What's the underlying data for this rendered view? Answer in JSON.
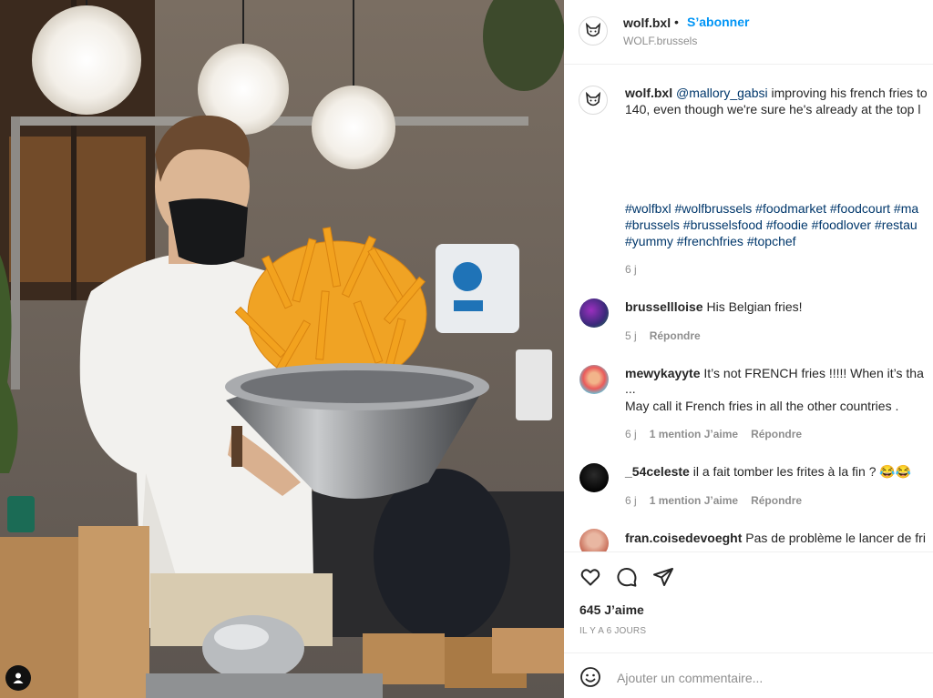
{
  "header": {
    "username": "wolf.bxl",
    "separator": "•",
    "follow_label": "S’abonner",
    "location": "WOLF.brussels"
  },
  "caption": {
    "username": "wolf.bxl",
    "mention": "@mallory_gabsi",
    "line1": "improving his french fries to",
    "line2": "140, even though we're sure he's already at the top l",
    "hashtags_line1": "#wolfbxl #wolfbrussels #foodmarket #foodcourt #ma",
    "hashtags_line2": "#brussels #brusselsfood #foodie #foodlover #restau",
    "hashtags_line3": "#yummy #frenchfries #topchef",
    "age": "6 j"
  },
  "comments": [
    {
      "username": "brussellloise",
      "text": "His Belgian fries!",
      "age": "5 j",
      "likes": "",
      "reply": "Répondre"
    },
    {
      "username": "mewykayyte",
      "text": "It’s not FRENCH fries !!!!! When it’s tha",
      "text2": "...",
      "text3": "May call it French fries in all the other countries .",
      "age": "6 j",
      "likes": "1 mention J’aime",
      "reply": "Répondre"
    },
    {
      "username": "_54celeste",
      "text": "il a fait tomber les frites à la fin ? 😂😂",
      "age": "6 j",
      "likes": "1 mention J’aime",
      "reply": "Répondre"
    },
    {
      "username": "fran.coisedevoeght",
      "text": "Pas de problème le lancer de fri"
    }
  ],
  "actions": {
    "icons": [
      "heart-icon",
      "comment-icon",
      "share-icon"
    ],
    "likes_count": "645 J’aime",
    "date": "IL Y A 6 JOURS"
  },
  "add_comment": {
    "placeholder": "Ajouter un commentaire..."
  },
  "colors": {
    "accent": "#0095f6",
    "hashtag": "#00376b",
    "muted": "#8e8e8e",
    "text": "#262626"
  }
}
